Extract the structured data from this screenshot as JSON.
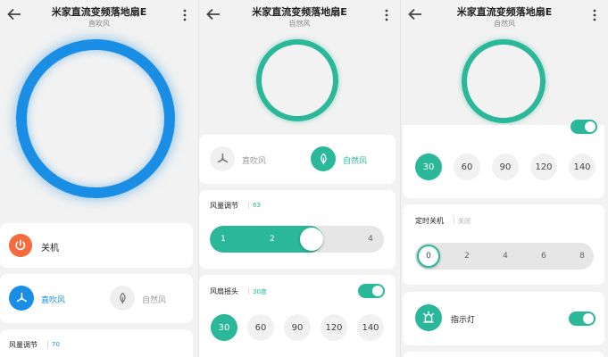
{
  "colors": {
    "teal": "#2bb79a",
    "blue": "#1a8de4",
    "orange": "#f36b3e",
    "track": "#e6e6e6"
  },
  "screens": [
    {
      "title": "米家直流变频落地扇E",
      "subtitle": "直吹风",
      "power_label": "关机",
      "mode_direct": "直吹风",
      "mode_natural": "自然风",
      "wind_label": "风量调节",
      "wind_value": "70"
    },
    {
      "title": "米家直流变频落地扇E",
      "subtitle": "自然风",
      "mode_direct": "直吹风",
      "mode_natural": "自然风",
      "wind_label": "风量调节",
      "wind_value": "63",
      "wind_level": 63,
      "wind_ticks": [
        "1",
        "2",
        "3",
        "4"
      ],
      "swing_label": "风扇摇头",
      "swing_value": "30度",
      "angles": [
        "30",
        "60",
        "90",
        "120",
        "140"
      ]
    },
    {
      "title": "米家直流变频落地扇E",
      "subtitle": "自然风",
      "angles": [
        "30",
        "60",
        "90",
        "120",
        "140"
      ],
      "timer_label": "定时关机",
      "timer_value": "关闭",
      "timer_ticks": [
        "0",
        "2",
        "4",
        "6",
        "8"
      ],
      "indicator_label": "指示灯"
    }
  ]
}
